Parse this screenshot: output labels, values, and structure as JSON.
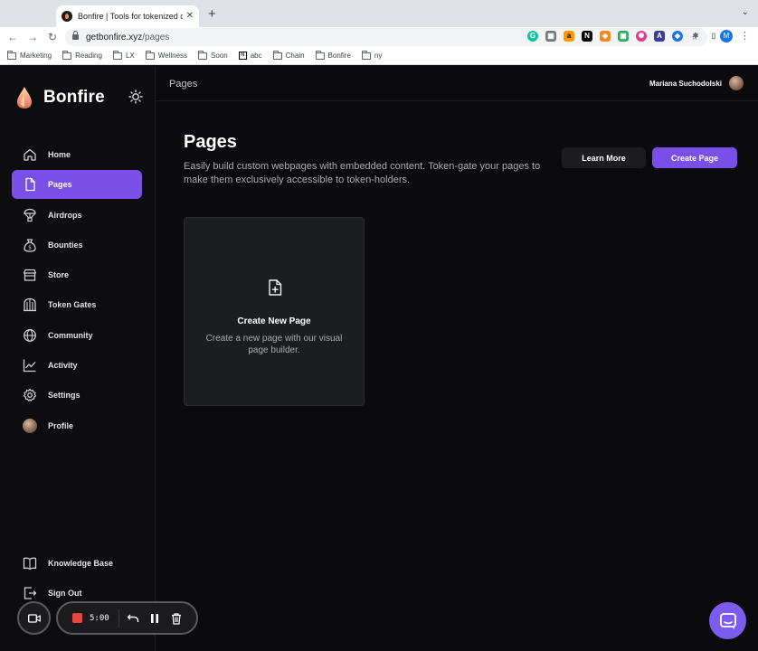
{
  "browser": {
    "tab_title": "Bonfire | Tools for tokenized creators",
    "url_domain": "getbonfire.xyz",
    "url_path": "/pages",
    "profile_initial": "M",
    "bookmarks": [
      "Marketing",
      "Reading",
      "LX",
      "Wellness",
      "Soon",
      "abc",
      "Chain",
      "Bonfire",
      "ny"
    ]
  },
  "app": {
    "brand": "Bonfire",
    "accent_color": "#7a4fe8",
    "header": {
      "title": "Pages",
      "user_name": "Mariana Suchodolski"
    },
    "sidebar": {
      "items": [
        {
          "label": "Home",
          "icon": "home-icon"
        },
        {
          "label": "Pages",
          "icon": "page-icon",
          "active": true
        },
        {
          "label": "Airdrops",
          "icon": "airdrop-icon"
        },
        {
          "label": "Bounties",
          "icon": "money-bag-icon"
        },
        {
          "label": "Store",
          "icon": "store-icon"
        },
        {
          "label": "Token Gates",
          "icon": "gate-icon"
        },
        {
          "label": "Community",
          "icon": "globe-icon"
        },
        {
          "label": "Activity",
          "icon": "chart-icon"
        },
        {
          "label": "Settings",
          "icon": "gear-icon"
        },
        {
          "label": "Profile",
          "icon": "avatar"
        }
      ],
      "footer": [
        {
          "label": "Knowledge Base",
          "icon": "book-icon"
        },
        {
          "label": "Sign Out",
          "icon": "sign-out-icon"
        }
      ]
    },
    "main": {
      "title": "Pages",
      "description": "Easily build custom webpages with embedded content. Token-gate your pages to make them exclusively accessible to token-holders.",
      "learn_more_label": "Learn More",
      "create_page_label": "Create Page",
      "card": {
        "title": "Create New Page",
        "description": "Create a new page with our visual page builder."
      }
    }
  },
  "recorder": {
    "time": "5:00"
  }
}
